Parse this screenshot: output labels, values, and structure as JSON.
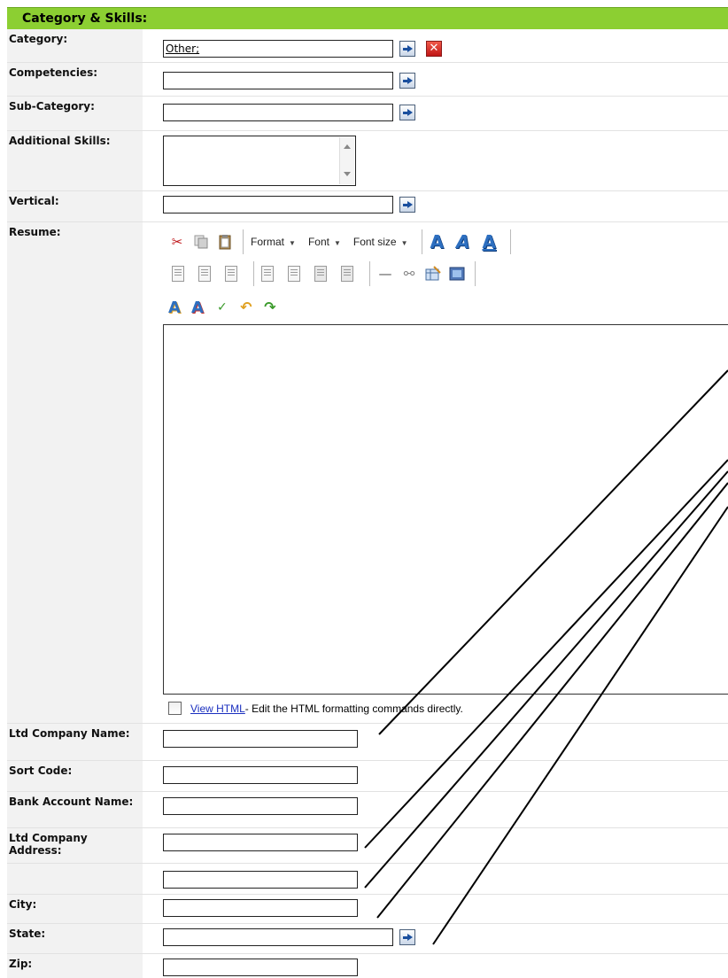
{
  "section": {
    "title": "Category & Skills:"
  },
  "fields": {
    "category": {
      "label": "Category:",
      "value": "Other;"
    },
    "competencies": {
      "label": "Competencies:",
      "value": ""
    },
    "sub_category": {
      "label": "Sub-Category:",
      "value": ""
    },
    "additional_skills": {
      "label": "Additional Skills:",
      "value": ""
    },
    "vertical": {
      "label": "Vertical:",
      "value": ""
    },
    "resume": {
      "label": "Resume:"
    },
    "ltd_company_name": {
      "label": "Ltd Company Name:",
      "value": ""
    },
    "sort_code": {
      "label": "Sort Code:",
      "value": ""
    },
    "bank_account_name": {
      "label": "Bank Account Name:",
      "value": ""
    },
    "ltd_company_address": {
      "label": "Ltd Company Address:",
      "value": ""
    },
    "address_line2": {
      "label": "",
      "value": ""
    },
    "city": {
      "label": "City:",
      "value": ""
    },
    "state": {
      "label": "State:",
      "value": ""
    },
    "zip": {
      "label": "Zip:",
      "value": ""
    }
  },
  "editor": {
    "format_label": "Format",
    "font_label": "Font",
    "font_size_label": "Font size",
    "view_html_link": "View HTML",
    "view_html_desc": " - Edit the HTML formatting commands directly."
  },
  "colors": {
    "header_bg": "#8ccf32",
    "label_col_bg": "#f2f2f2",
    "link": "#1a2fbf"
  }
}
